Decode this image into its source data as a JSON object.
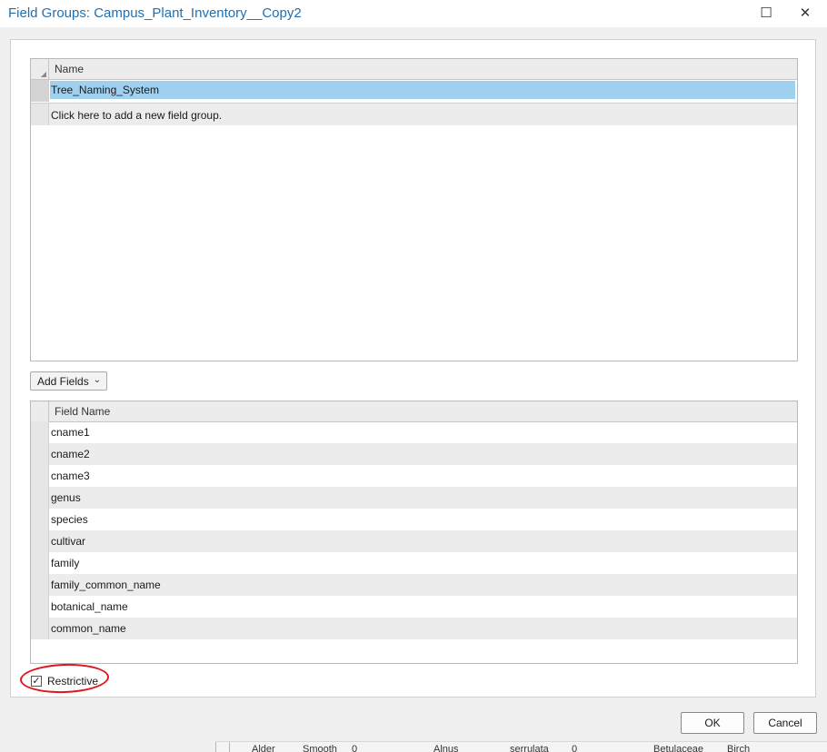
{
  "window": {
    "title": "Field Groups: Campus_Plant_Inventory__Copy2",
    "maximize_glyph": "☐",
    "close_glyph": "✕"
  },
  "groups_grid": {
    "column_header": "Name",
    "rows": [
      "Tree_Naming_System"
    ],
    "add_row_text": "Click here to add a new field group."
  },
  "add_fields": {
    "label": "Add Fields",
    "chevron": "⌄"
  },
  "fields_grid": {
    "column_header": "Field Name",
    "rows": [
      "cname1",
      "cname2",
      "cname3",
      "genus",
      "species",
      "cultivar",
      "family",
      "family_common_name",
      "botanical_name",
      "common_name"
    ]
  },
  "restrictive": {
    "label": "Restrictive",
    "checked": true,
    "check_glyph": "✓"
  },
  "buttons": {
    "ok": "OK",
    "cancel": "Cancel"
  },
  "background_table_fragment": [
    "Alder",
    "Smooth",
    "0",
    "Alnus",
    "serrulata",
    "0",
    "Betulaceae",
    "Birch"
  ]
}
